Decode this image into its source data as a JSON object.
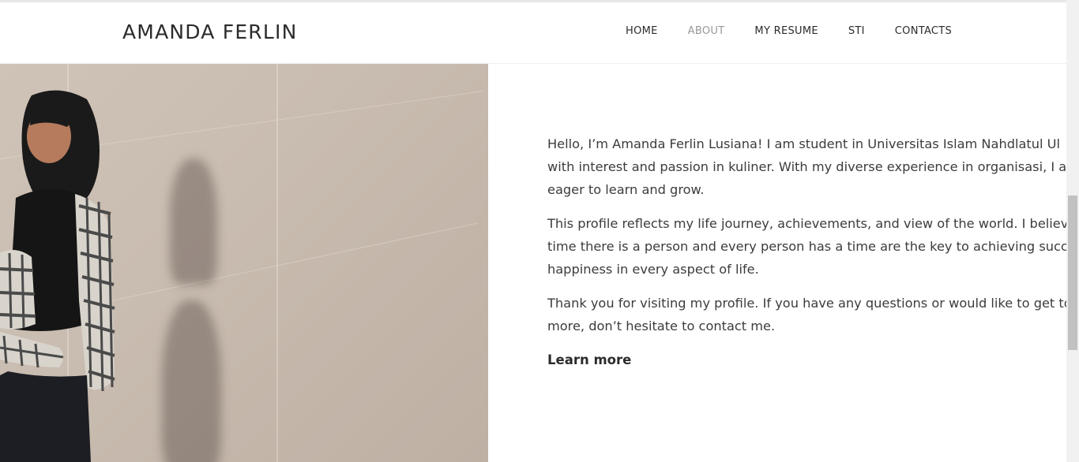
{
  "site": {
    "logo": "AMANDA FERLIN"
  },
  "nav": {
    "items": [
      {
        "label": "HOME",
        "active": false
      },
      {
        "label": "ABOUT",
        "active": true
      },
      {
        "label": "MY RESUME",
        "active": false
      },
      {
        "label": "STI",
        "active": false
      },
      {
        "label": "CONTACTS",
        "active": false
      }
    ]
  },
  "about": {
    "paragraph1": [
      "Hello, I’m Amanda Ferlin Lusiana! I am student in Universitas Islam Nahdlatul Ul",
      "with interest and passion in kuliner. With my diverse experience in organisasi, I a",
      "eager to learn and grow."
    ],
    "paragraph2": [
      "This profile reflects my life journey, achievements, and view of the world. I believe",
      "time there is a person and every person has a time are the key to achieving succe",
      "happiness in every aspect of life."
    ],
    "paragraph3": [
      "Thank you for visiting my profile. If you have any questions or would like to get to",
      "more, don’t hesitate to contact me."
    ],
    "learn_more": "Learn more"
  },
  "colors": {
    "text": "#3c3c3c",
    "heading": "#2b2b2b",
    "nav_active": "#999999",
    "photo_wall": "#c9bcb0"
  }
}
